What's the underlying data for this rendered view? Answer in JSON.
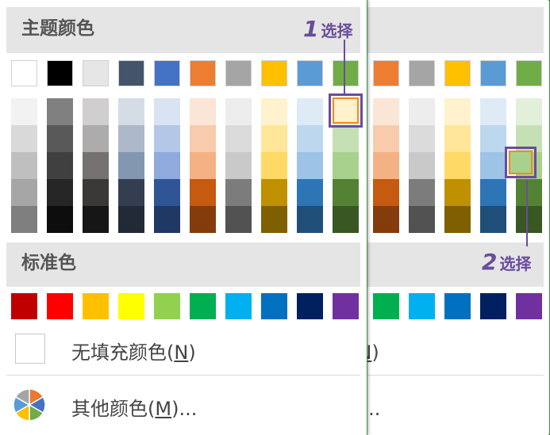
{
  "theme_section": {
    "title": "主题颜色"
  },
  "standard_section": {
    "title": "标准色"
  },
  "no_fill": {
    "label": "无填充颜色",
    "mnemonic": "N",
    "suffix": ")"
  },
  "more_colors": {
    "label": "其他颜色",
    "mnemonic": "M",
    "suffix": ")..."
  },
  "callouts": [
    {
      "number": "1",
      "text": "选择"
    },
    {
      "number": "2",
      "text": "选择"
    }
  ],
  "theme_columns": [
    {
      "base": "#ffffff",
      "shades": [
        "#f2f2f2",
        "#d9d9d9",
        "#bfbfbf",
        "#a6a6a6",
        "#7f7f7f"
      ]
    },
    {
      "base": "#000000",
      "shades": [
        "#808080",
        "#595959",
        "#404040",
        "#262626",
        "#0d0d0d"
      ]
    },
    {
      "base": "#e7e6e6",
      "shades": [
        "#d0cece",
        "#aeabab",
        "#767171",
        "#3b3838",
        "#171616"
      ]
    },
    {
      "base": "#44546a",
      "shades": [
        "#d6dce5",
        "#adb9ca",
        "#8497b0",
        "#333f50",
        "#222a35"
      ]
    },
    {
      "base": "#4472c4",
      "shades": [
        "#dae3f3",
        "#b4c7e7",
        "#8faadc",
        "#2f5597",
        "#1f3864"
      ]
    },
    {
      "base": "#ed7d31",
      "shades": [
        "#fbe5d6",
        "#f8cbad",
        "#f4b183",
        "#c55a11",
        "#843c0c"
      ]
    },
    {
      "base": "#a5a5a5",
      "shades": [
        "#ededed",
        "#dbdbdb",
        "#c9c9c9",
        "#7c7c7c",
        "#525252"
      ]
    },
    {
      "base": "#ffc000",
      "shades": [
        "#fff2cc",
        "#ffe699",
        "#ffd966",
        "#bf9000",
        "#7f6000"
      ]
    },
    {
      "base": "#5b9bd5",
      "shades": [
        "#deebf7",
        "#bdd7ee",
        "#9dc3e6",
        "#2e75b6",
        "#1f4e79"
      ]
    },
    {
      "base": "#70ad47",
      "shades": [
        "#e2f0d9",
        "#c5e0b4",
        "#a9d18e",
        "#548235",
        "#385723"
      ]
    }
  ],
  "standard_colors": [
    "#c00000",
    "#ff0000",
    "#ffc000",
    "#ffff00",
    "#92d050",
    "#00b050",
    "#00b0f0",
    "#0070c0",
    "#002060",
    "#7030a0"
  ],
  "pie_colors": [
    "#e97a2f",
    "#4472c4",
    "#70ad47",
    "#ffc000",
    "#5b9bd5",
    "#a5a5a5"
  ]
}
